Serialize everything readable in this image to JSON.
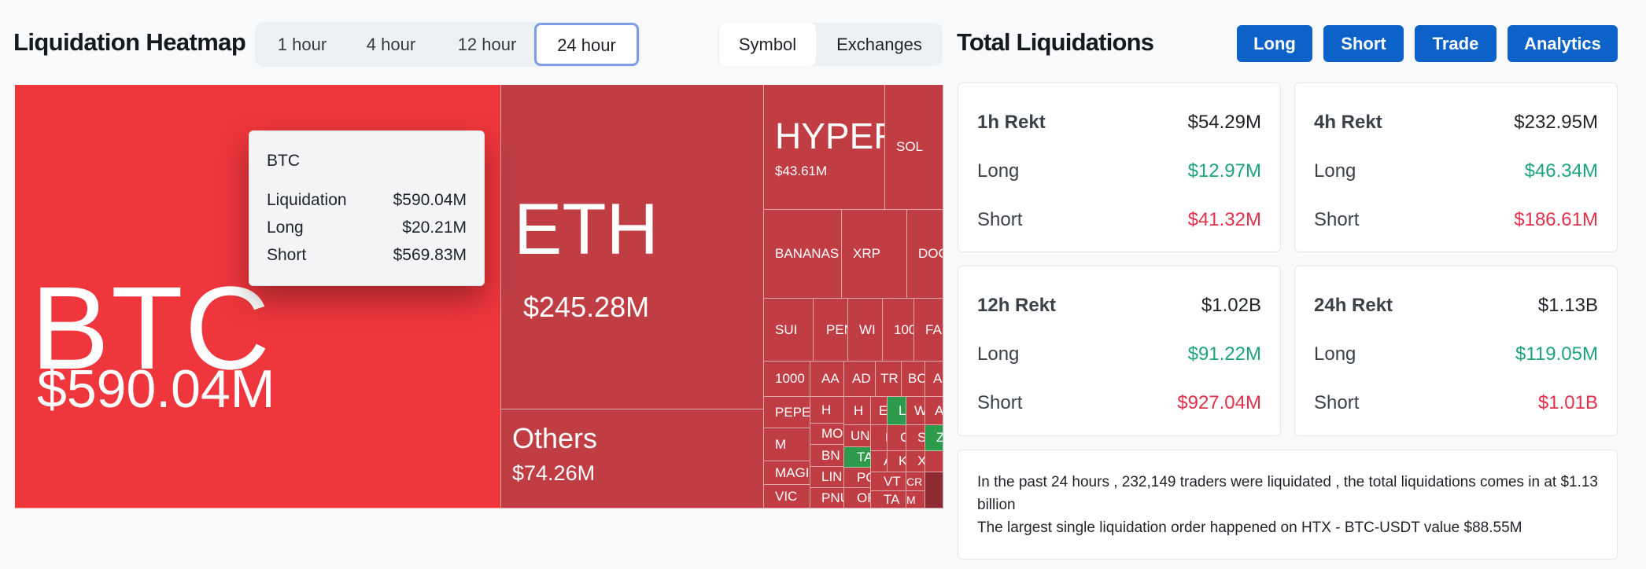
{
  "header_left": {
    "title": "Liquidation Heatmap",
    "timeframes": [
      "1 hour",
      "4 hour",
      "12 hour",
      "24 hour"
    ],
    "active_timeframe": "24 hour",
    "view_toggle": [
      "Symbol",
      "Exchanges"
    ],
    "active_view": "Symbol"
  },
  "heatmap": {
    "tiles": {
      "btc": {
        "name": "BTC",
        "value": "$590.04M"
      },
      "eth": {
        "name": "ETH",
        "value": "$245.28M"
      },
      "others": {
        "name": "Others",
        "value": "$74.26M"
      },
      "hyper": {
        "name": "HYPER",
        "value": "$43.61M"
      },
      "sol": {
        "name": "SOL"
      },
      "bananas": {
        "name": "BANANAS"
      },
      "xrp": {
        "name": "XRP"
      },
      "doge": {
        "name": "DOG"
      },
      "sui": {
        "name": "SUI"
      },
      "pen": {
        "name": "PEN"
      },
      "wif": {
        "name": "WI"
      },
      "t100": {
        "name": "100"
      },
      "fa": {
        "name": "FA"
      },
      "t1000": {
        "name": "1000"
      },
      "aa": {
        "name": "AA"
      },
      "ad": {
        "name": "AD"
      },
      "tr": {
        "name": "TR"
      },
      "bo": {
        "name": "BC"
      },
      "a1": {
        "name": "A"
      },
      "pepe": {
        "name": "PEPE"
      },
      "h": {
        "name": "H"
      },
      "mo": {
        "name": "MO"
      },
      "m": {
        "name": "M"
      },
      "bn": {
        "name": "BN"
      },
      "ta": {
        "name": "TA"
      },
      "magic": {
        "name": "MAGI"
      },
      "lin": {
        "name": "LIN"
      },
      "vic": {
        "name": "VIC"
      },
      "pn": {
        "name": "PNU"
      },
      "po": {
        "name": "PO"
      },
      "or": {
        "name": "OR"
      },
      "un": {
        "name": "UN"
      },
      "hh": {
        "name": "H"
      },
      "ee": {
        "name": "E"
      },
      "ll": {
        "name": "L"
      },
      "ww": {
        "name": "W"
      },
      "aa2": {
        "name": "A"
      },
      "ff": {
        "name": "F"
      },
      "cc": {
        "name": "C"
      },
      "ss": {
        "name": "S"
      },
      "zz": {
        "name": "Z"
      },
      "a3": {
        "name": "A"
      },
      "vt": {
        "name": "VT"
      },
      "tt": {
        "name": "TA"
      },
      "cr": {
        "name": "CR"
      },
      "mm": {
        "name": "M"
      },
      "kk": {
        "name": "K"
      },
      "xx": {
        "name": "X"
      }
    },
    "tooltip": {
      "symbol": "BTC",
      "liquidation_label": "Liquidation",
      "liquidation_value": "$590.04M",
      "long_label": "Long",
      "long_value": "$20.21M",
      "short_label": "Short",
      "short_value": "$569.83M"
    }
  },
  "header_right": {
    "title": "Total Liquidations",
    "buttons": [
      "Long",
      "Short",
      "Trade",
      "Analytics"
    ]
  },
  "cards": [
    {
      "title": "1h Rekt",
      "total": "$54.29M",
      "long_label": "Long",
      "long": "$12.97M",
      "short_label": "Short",
      "short": "$41.32M"
    },
    {
      "title": "4h Rekt",
      "total": "$232.95M",
      "long_label": "Long",
      "long": "$46.34M",
      "short_label": "Short",
      "short": "$186.61M"
    },
    {
      "title": "12h Rekt",
      "total": "$1.02B",
      "long_label": "Long",
      "long": "$91.22M",
      "short_label": "Short",
      "short": "$927.04M"
    },
    {
      "title": "24h Rekt",
      "total": "$1.13B",
      "long_label": "Long",
      "long": "$119.05M",
      "short_label": "Short",
      "short": "$1.01B"
    }
  ],
  "summary": {
    "line1": "In the past 24 hours , 232,149 traders were liquidated , the total liquidations comes in at $1.13 billion",
    "line2": "The largest single liquidation order happened on HTX - BTC-USDT value $88.55M"
  },
  "colors": {
    "btc_tile": "#ef363c",
    "tile": "#c13d44",
    "positive_tile": "#2e9a4b",
    "long_text": "#1ca47e",
    "short_text": "#e2304a",
    "button": "#0d62c9"
  }
}
